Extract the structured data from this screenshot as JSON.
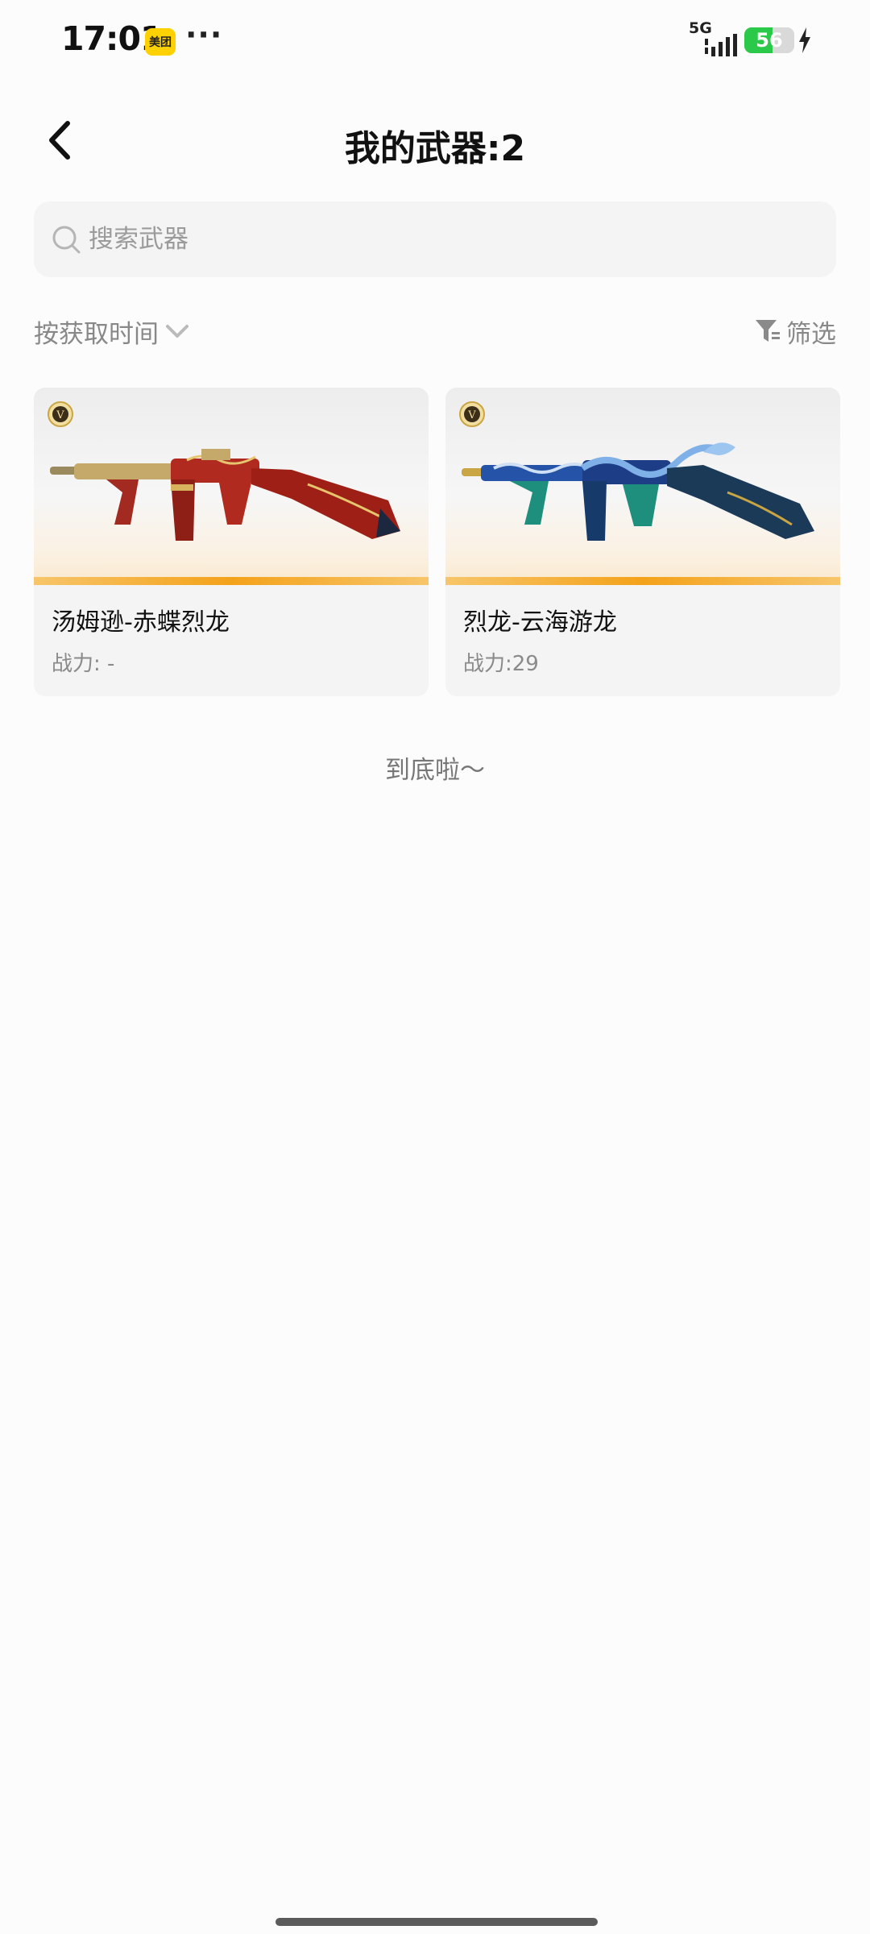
{
  "status_bar": {
    "time": "17:01",
    "app_badge": "美团",
    "more_dots": "···",
    "network": "5G",
    "battery_level": "56",
    "battery_fraction": 0.56,
    "battery_color": "#2bc94a"
  },
  "header": {
    "back_icon": "chevron-left-icon",
    "title": "我的武器:2"
  },
  "search": {
    "icon": "search-icon",
    "placeholder": "搜索武器",
    "value": ""
  },
  "toolbar": {
    "sort_label": "按获取时间",
    "sort_icon": "chevron-down-icon",
    "filter_label": "筛选",
    "filter_icon": "filter-icon"
  },
  "weapons": [
    {
      "name": "汤姆逊-赤蝶烈龙",
      "power": "战力: -",
      "rank_icon": "rank-v-icon",
      "accent": "#b3261e"
    },
    {
      "name": "烈龙-云海游龙",
      "power": "战力:29",
      "rank_icon": "rank-v-icon",
      "accent": "#2a56b8"
    }
  ],
  "footer": {
    "end_text": "到底啦～"
  },
  "colors": {
    "rarity_stripe": "#f4a21a",
    "card_bg": "#f4f4f4"
  }
}
